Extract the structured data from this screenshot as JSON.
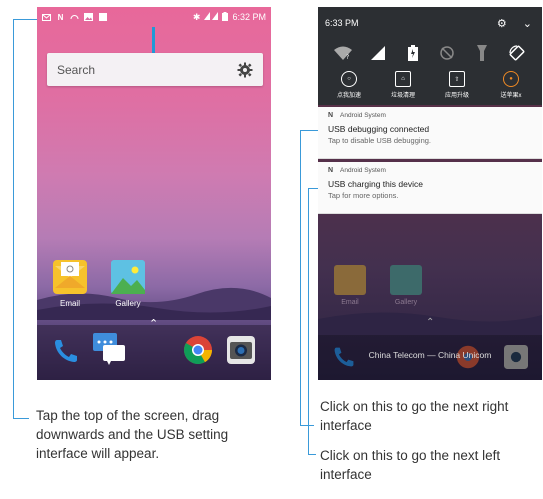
{
  "left_phone": {
    "status_time": "6:32 PM",
    "search_placeholder": "Search",
    "apps": [
      {
        "label": "Email"
      },
      {
        "label": "Gallery"
      }
    ],
    "icons": {
      "gear": "gear-icon",
      "phone": "phone-icon",
      "messages": "messages-icon",
      "chrome": "chrome-icon",
      "camera": "camera-icon"
    }
  },
  "right_phone": {
    "status_time": "6:33 PM",
    "qs_tiles": [
      {
        "label": "点我加速"
      },
      {
        "label": "垃圾清理"
      },
      {
        "label": "应用升级"
      },
      {
        "label": "送苹果x"
      }
    ],
    "notifications": [
      {
        "app": "Android System",
        "title": "USB debugging connected",
        "body": "Tap to disable USB debugging."
      },
      {
        "app": "Android System",
        "title": "USB charging this device",
        "body": "Tap for more options."
      }
    ],
    "carrier": "China Telecom — China Unicom",
    "dim_apps": [
      {
        "label": "Email"
      },
      {
        "label": "Gallery"
      }
    ]
  },
  "captions": {
    "left": "Tap the top of the screen, drag downwards and the USB setting interface will appear.",
    "right_upper": "Click on this to go the next right interface",
    "right_lower": "Click on this to go the next left interface"
  },
  "colors": {
    "accent": "#3a9ad9",
    "arrow": "#1e9ad6"
  }
}
